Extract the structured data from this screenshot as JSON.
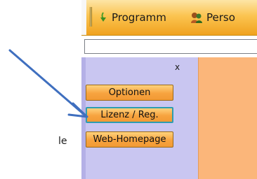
{
  "toolbar": {
    "items": [
      {
        "label": "Programm",
        "icon": "arrow-down-icon"
      },
      {
        "label": "Perso",
        "icon": "people-icon"
      }
    ]
  },
  "panel": {
    "close_label": "x",
    "buttons": [
      {
        "label": "Optionen"
      },
      {
        "label": "Lizenz / Reg.",
        "active": true
      },
      {
        "label": "Web-Homepage"
      }
    ]
  },
  "stray_text": "le",
  "colors": {
    "toolbar_orange": "#fbc451",
    "panel_lavender": "#c9c6f1",
    "content_peach": "#fbb67a",
    "button_orange": "#f7a33f",
    "active_border": "#2e9db0",
    "arrow_blue": "#3f6fbf"
  }
}
